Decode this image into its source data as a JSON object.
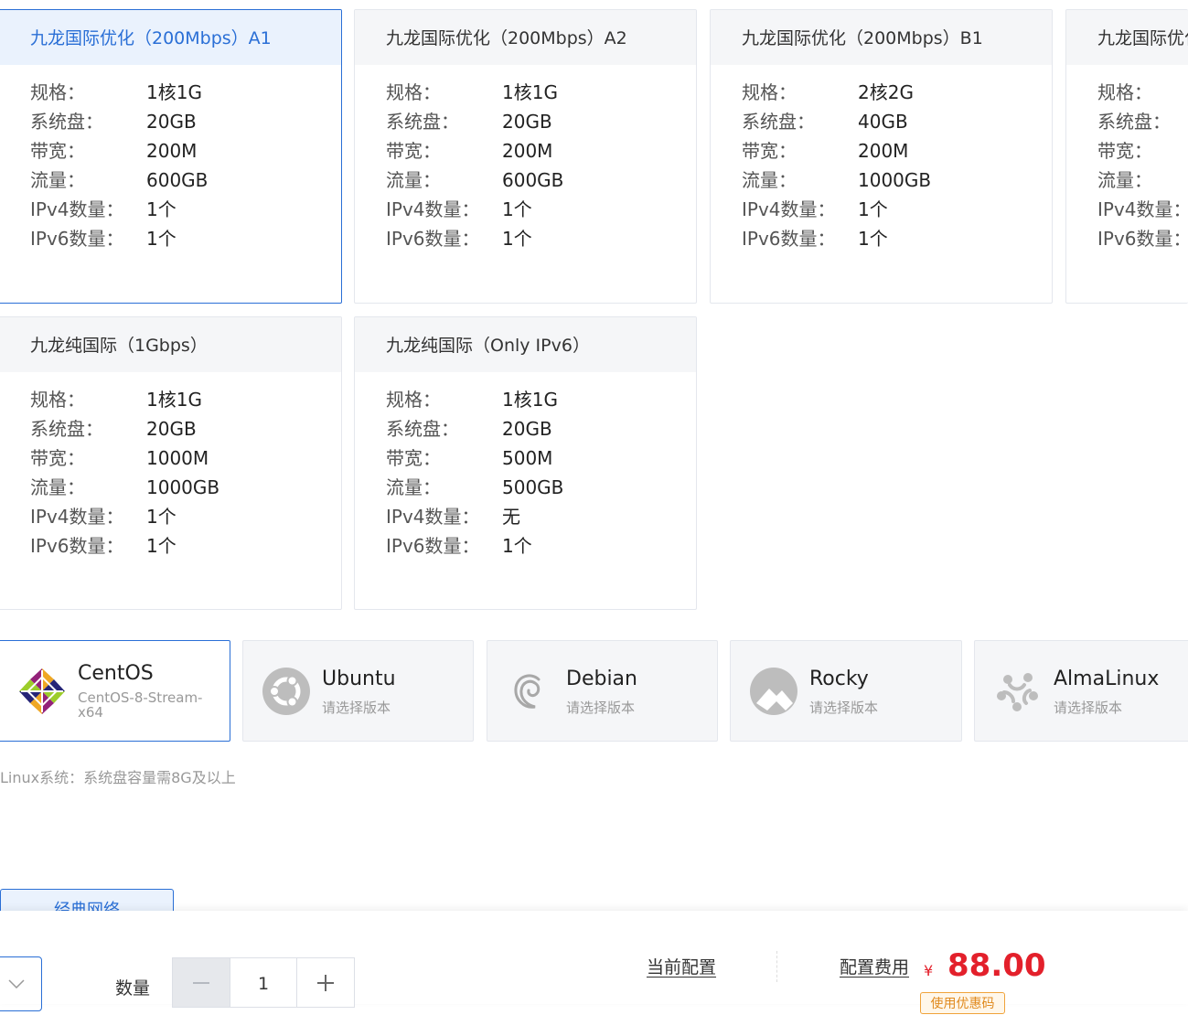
{
  "plans": [
    {
      "title": "九龙国际优化（200Mbps）A1",
      "specs": [
        "1核1G",
        "20GB",
        "200M",
        "600GB",
        "1个",
        "1个"
      ]
    },
    {
      "title": "九龙国际优化（200Mbps）A2",
      "specs": [
        "1核1G",
        "20GB",
        "200M",
        "600GB",
        "1个",
        "1个"
      ]
    },
    {
      "title": "九龙国际优化（200Mbps）B1",
      "specs": [
        "2核2G",
        "40GB",
        "200M",
        "1000GB",
        "1个",
        "1个"
      ]
    },
    {
      "title": "九龙国际优化"
    },
    {
      "title": "九龙纯国际（1Gbps）",
      "specs": [
        "1核1G",
        "20GB",
        "1000M",
        "1000GB",
        "1个",
        "1个"
      ]
    },
    {
      "title": "九龙纯国际（Only IPv6）",
      "specs": [
        "1核1G",
        "20GB",
        "500M",
        "500GB",
        "无",
        "1个"
      ]
    }
  ],
  "spec_labels": [
    "规格：",
    "系统盘：",
    "带宽：",
    "流量：",
    "IPv4数量：",
    "IPv6数量："
  ],
  "os": [
    {
      "name": "CentOS",
      "sub": "CentOS-8-Stream-x64",
      "icon": "centos-icon"
    },
    {
      "name": "Ubuntu",
      "sub": "请选择版本",
      "icon": "ubuntu-icon"
    },
    {
      "name": "Debian",
      "sub": "请选择版本",
      "icon": "debian-icon"
    },
    {
      "name": "Rocky",
      "sub": "请选择版本",
      "icon": "rocky-icon"
    },
    {
      "name": "AlmaLinux",
      "sub": "请选择版本",
      "icon": "almalinux-icon"
    }
  ],
  "os_note": "Linux系统：系统盘容量需8G及以上",
  "network_tab": "经典网络",
  "bottom": {
    "quantity_label": "数量",
    "quantity_value": "1",
    "current_config": "当前配置",
    "fee_label": "配置费用",
    "currency": "¥",
    "price": "88.00",
    "coupon": "使用优惠码"
  },
  "colors": {
    "accent": "#2a6fd6",
    "price": "#e3202b",
    "coupon": "#e08a1e"
  }
}
